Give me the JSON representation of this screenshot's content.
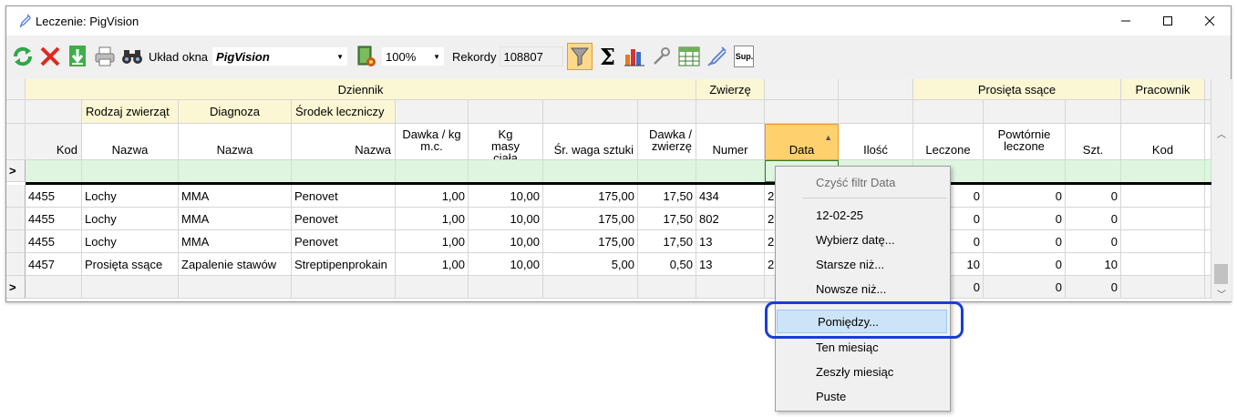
{
  "window": {
    "title": "Leczenie: PigVision"
  },
  "toolbar": {
    "layout_label": "Układ okna",
    "layout_value": "PigVision",
    "zoom_value": "100%",
    "records_label": "Rekordy",
    "records_value": "108807",
    "sup_label": "Sup.",
    "sigma": "Σ"
  },
  "grid": {
    "groups": {
      "dziennik": "Dziennik",
      "zwierze": "Zwierzę",
      "prosieta": "Prosięta ssące",
      "pracownik": "Pracownik"
    },
    "subgroups": {
      "rodzaj": "Rodzaj zwierząt",
      "diagnoza": "Diagnoza",
      "srodek": "Środek leczniczy"
    },
    "columns": {
      "kod": "Kod",
      "nazwa1": "Nazwa",
      "nazwa2": "Nazwa",
      "nazwa3": "Nazwa",
      "dawka_kg": "Dawka / kg m.c.",
      "kg_masy": "Kg masy ciała",
      "sr_waga": "Śr. waga sztuki",
      "dawka_zw": "Dawka / zwierzę",
      "numer": "Numer",
      "data": "Data",
      "ilosc": "Ilość",
      "leczone": "Leczone",
      "powtornie": "Powtórnie leczone",
      "szt": "Szt.",
      "prac_kod": "Kod"
    },
    "rows": [
      {
        "kod": "4455",
        "rodzaj": "Lochy",
        "diagnoza": "MMA",
        "srodek": "Penovet",
        "dawka_kg": "1,00",
        "kg_masy": "10,00",
        "sr_waga": "175,00",
        "dawka_zw": "17,50",
        "numer": "434",
        "data": "2",
        "leczone": "0",
        "powtornie": "0",
        "szt": "0"
      },
      {
        "kod": "4455",
        "rodzaj": "Lochy",
        "diagnoza": "MMA",
        "srodek": "Penovet",
        "dawka_kg": "1,00",
        "kg_masy": "10,00",
        "sr_waga": "175,00",
        "dawka_zw": "17,50",
        "numer": "802",
        "data": "2",
        "leczone": "0",
        "powtornie": "0",
        "szt": "0"
      },
      {
        "kod": "4455",
        "rodzaj": "Lochy",
        "diagnoza": "MMA",
        "srodek": "Penovet",
        "dawka_kg": "1,00",
        "kg_masy": "10,00",
        "sr_waga": "175,00",
        "dawka_zw": "17,50",
        "numer": "13",
        "data": "2",
        "leczone": "0",
        "powtornie": "0",
        "szt": "0"
      },
      {
        "kod": "4457",
        "rodzaj": "Prosięta ssące",
        "diagnoza": "Zapalenie stawów",
        "srodek": "Streptipenprokain",
        "dawka_kg": "1,00",
        "kg_masy": "10,00",
        "sr_waga": "5,00",
        "dawka_zw": "0,50",
        "numer": "13",
        "data": "2",
        "leczone": "10",
        "powtornie": "0",
        "szt": "10"
      }
    ],
    "totals": {
      "leczone": "0",
      "powtornie": "0",
      "szt": "0"
    }
  },
  "context_menu": {
    "items": [
      {
        "label": "Czyść filtr Data"
      },
      {
        "label": "12-02-25"
      },
      {
        "label": "Wybierz datę..."
      },
      {
        "label": "Starsze niż..."
      },
      {
        "label": "Nowsze niż..."
      },
      {
        "label": "Pomiędzy..."
      },
      {
        "label": "Ten miesiąc"
      },
      {
        "label": "Zeszły miesiąc"
      },
      {
        "label": "Puste"
      }
    ]
  },
  "colors": {
    "accent": "#1a3dd6",
    "group_yellow": "#fbf7d4",
    "filter_green": "#dff5df",
    "sorted_header": "#ffd06e"
  }
}
